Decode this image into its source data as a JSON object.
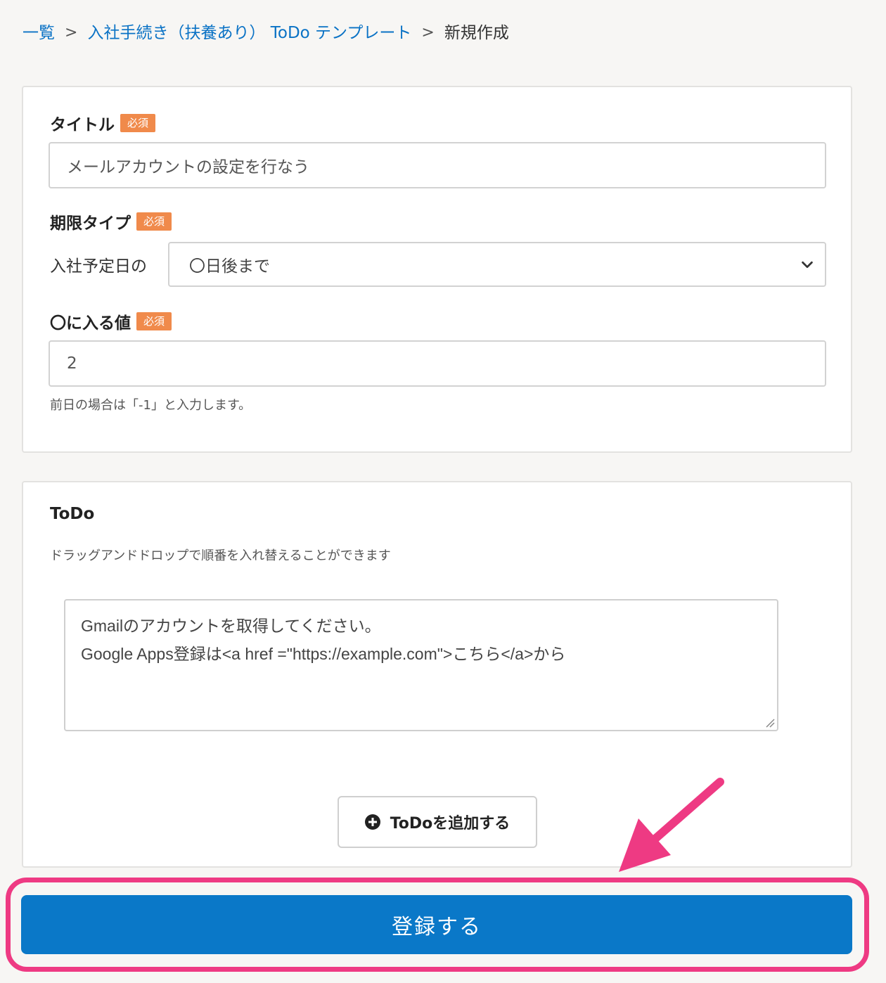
{
  "breadcrumb": {
    "items": [
      {
        "label": "一覧"
      },
      {
        "label": "入社手続き（扶養あり） ToDo テンプレート"
      }
    ],
    "separator": ">",
    "current": "新規作成"
  },
  "form": {
    "required_badge": "必須",
    "title": {
      "label": "タイトル",
      "value": "メールアカウントの設定を行なう"
    },
    "deadline_type": {
      "label": "期限タイプ",
      "prefix": "入社予定日の",
      "selected": "〇日後まで",
      "icon": "chevron-down-icon"
    },
    "offset_value": {
      "label": "〇に入る値",
      "value": "2",
      "help": "前日の場合は「-1」と入力します。"
    }
  },
  "todo": {
    "title": "ToDo",
    "hint": "ドラッグアンドドロップで順番を入れ替えることができます",
    "items": [
      {
        "lines": [
          "Gmailのアカウントを取得してください。",
          "Google Apps登録は<a href =\"https://example.com\">こちら</a>から"
        ]
      }
    ],
    "add_button_label": "ToDoを追加する",
    "add_icon": "plus-circle-icon"
  },
  "submit_label": "登録する",
  "annotation": {
    "highlight_color": "#ee3a83"
  },
  "colors": {
    "link": "#0a72c5",
    "primary": "#0a78c8",
    "badge": "#f08a4b"
  }
}
